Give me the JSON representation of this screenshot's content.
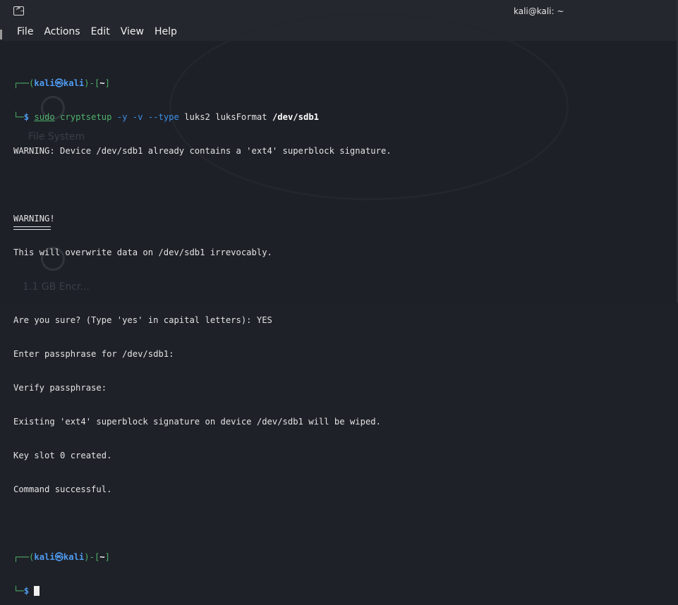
{
  "window": {
    "title": "kali@kali: ~",
    "icon": "terminal-icon"
  },
  "menu": [
    "File",
    "Actions",
    "Edit",
    "View",
    "Help"
  ],
  "desktop_ghost": {
    "label1": "File System",
    "label2": "1.1 GB Encr..."
  },
  "terminal": {
    "prompt1": {
      "open": "┌──(",
      "user": "kali",
      "at": "㉿",
      "host": "kali",
      "mid": ")-[",
      "dir": "~",
      "close": "]",
      "arrow": "└─",
      "dollar": "$"
    },
    "command": {
      "sudo": "sudo",
      "cmd": "cryptsetup",
      "opts": "-y -v --type",
      "args": "luks2 luksFormat",
      "device": "/dev/sdb1"
    },
    "output": [
      "WARNING: Device /dev/sdb1 already contains a 'ext4' superblock signature.",
      "",
      "WARNING!",
      "This will overwrite data on /dev/sdb1 irrevocably.",
      "",
      "Are you sure? (Type 'yes' in capital letters): YES",
      "Enter passphrase for /dev/sdb1:",
      "Verify passphrase:",
      "Existing 'ext4' superblock signature on device /dev/sdb1 will be wiped.",
      "Key slot 0 created.",
      "Command successful."
    ],
    "prompt2": {
      "open": "┌──(",
      "user": "kali",
      "at": "㉿",
      "host": "kali",
      "mid": ")-[",
      "dir": "~",
      "close": "]",
      "arrow": "└─",
      "dollar": "$"
    }
  },
  "colors": {
    "prompt_blue": "#3d8fe8",
    "command_green": "#4fb26b",
    "background": "#1d2027"
  }
}
